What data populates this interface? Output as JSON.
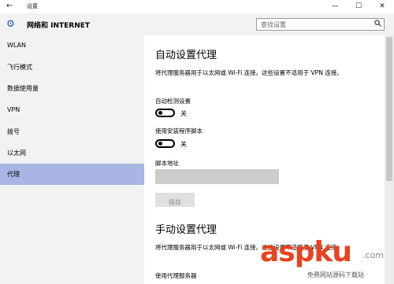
{
  "window": {
    "title": "设置",
    "back_glyph": "←",
    "minimize_glyph": "—",
    "maximize_glyph": "☐",
    "close_glyph": "✕"
  },
  "header": {
    "title": "网络和 INTERNET",
    "search_placeholder": "查找设置"
  },
  "sidebar": {
    "items": [
      {
        "label": "WLAN"
      },
      {
        "label": "飞行模式"
      },
      {
        "label": "数据使用量"
      },
      {
        "label": "VPN"
      },
      {
        "label": "拨号"
      },
      {
        "label": "以太网"
      },
      {
        "label": "代理"
      }
    ],
    "active_index": 6
  },
  "auto_proxy": {
    "heading": "自动设置代理",
    "description": "将代理服务器用于以太网或 Wi-Fi 连接。这些设置不适用于 VPN 连接。",
    "detect_label": "自动检测设置",
    "detect_state": "关",
    "script_label": "使用安装程序脚本",
    "script_state": "关",
    "address_label": "脚本地址",
    "address_value": "",
    "save_label": "保存"
  },
  "manual_proxy": {
    "heading": "手动设置代理",
    "description": "将代理服务器用于以太网或 Wi-Fi 连接。这些设置不适用于 VPN 连接。",
    "use_server_label": "使用代理服务器"
  },
  "watermark": {
    "main": "aspku",
    "tld": ".com",
    "sub": "免费网站源码下载站"
  },
  "colors": {
    "accent_active": "#a9b6e4",
    "sidebar_bg": "#f2f2f2",
    "watermark": "#e8431f"
  }
}
